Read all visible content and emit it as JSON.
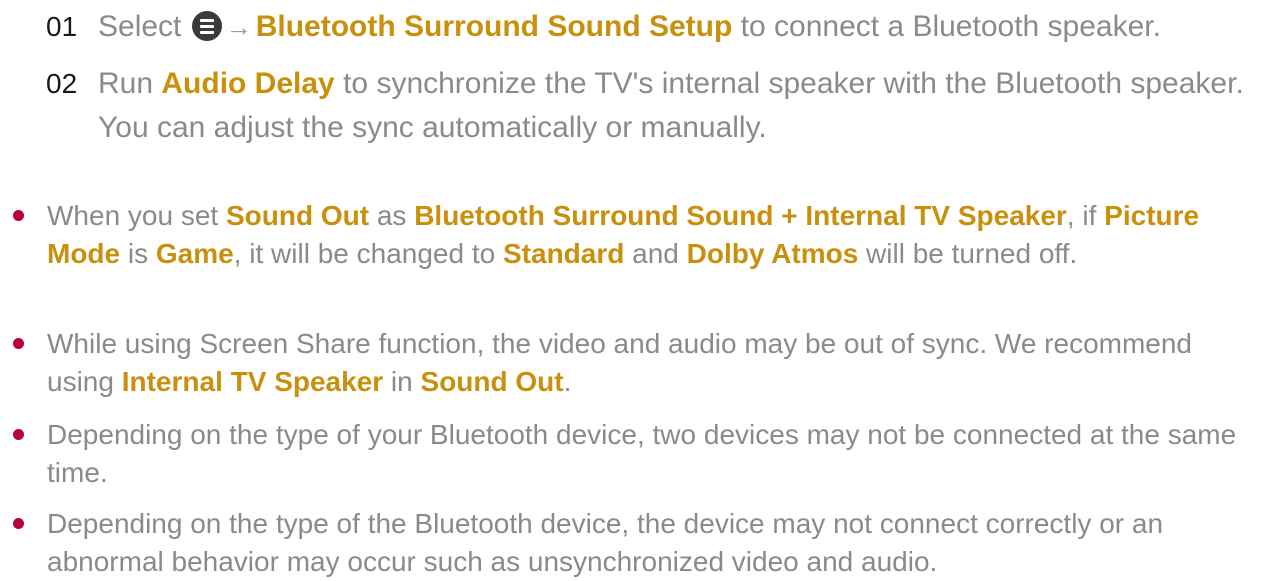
{
  "steps": [
    {
      "number": "01",
      "parts": [
        {
          "t": "Select ",
          "hl": false
        },
        {
          "icon": "menu-icon"
        },
        {
          "arrow": "→"
        },
        {
          "t": "Bluetooth Surround Sound Setup",
          "hl": true
        },
        {
          "t": " to connect a Bluetooth speaker.",
          "hl": false
        }
      ]
    },
    {
      "number": "02",
      "parts": [
        {
          "t": "Run ",
          "hl": false
        },
        {
          "t": "Audio Delay",
          "hl": true
        },
        {
          "t": " to synchronize the TV's internal speaker with the Bluetooth speaker. You can adjust the sync automatically or manually.",
          "hl": false
        }
      ]
    }
  ],
  "notes": [
    {
      "parts": [
        {
          "t": "When you set ",
          "hl": false
        },
        {
          "t": "Sound Out",
          "hl": true
        },
        {
          "t": " as ",
          "hl": false
        },
        {
          "t": "Bluetooth Surround Sound + Internal TV Speaker",
          "hl": true
        },
        {
          "t": ", if ",
          "hl": false
        },
        {
          "t": "Picture Mode",
          "hl": true
        },
        {
          "t": " is ",
          "hl": false
        },
        {
          "t": "Game",
          "hl": true
        },
        {
          "t": ", it will be changed to ",
          "hl": false
        },
        {
          "t": "Standard",
          "hl": true
        },
        {
          "t": " and ",
          "hl": false
        },
        {
          "t": "Dolby Atmos",
          "hl": true
        },
        {
          "t": " will be turned off.",
          "hl": false
        }
      ]
    },
    {
      "parts": [
        {
          "t": "While using Screen Share function, the video and audio may be out of sync. We recommend using ",
          "hl": false
        },
        {
          "t": "Internal TV Speaker",
          "hl": true
        },
        {
          "t": " in ",
          "hl": false
        },
        {
          "t": "Sound Out",
          "hl": true
        },
        {
          "t": ".",
          "hl": false
        }
      ]
    },
    {
      "parts": [
        {
          "t": "Depending on the type of your Bluetooth device, two devices may not be connected at the same time.",
          "hl": false
        }
      ]
    },
    {
      "parts": [
        {
          "t": "Depending on the type of the Bluetooth device, the device may not connect correctly or an abnormal behavior may occur such as unsynchronized video and audio.",
          "hl": false
        }
      ]
    }
  ],
  "colors": {
    "highlight": "#c8900c",
    "body_text": "#8a8a8a",
    "step_number": "#1a1a1a",
    "bullet": "#b8003a"
  }
}
